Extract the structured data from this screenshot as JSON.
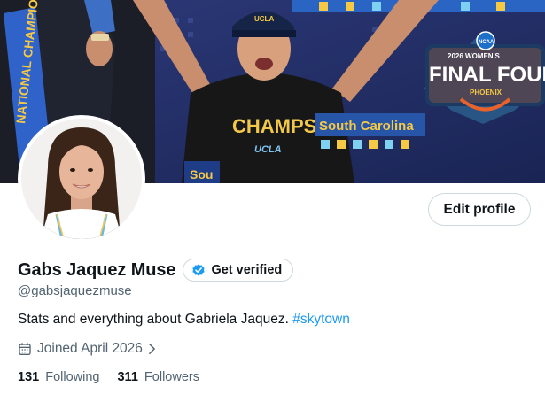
{
  "banner": {
    "left_banner_text": "NATIONAL CHAMPIONS",
    "shirt_text": "CHAMPS",
    "shirt_subtext": "UCLA",
    "sign_text": "South Carolina",
    "lower_sign_text": "Sou",
    "cap_text": "UCLA",
    "logo": {
      "top_line": "2026 WOMEN'S",
      "main_line": "FINAL FOUR",
      "city": "PHOENIX",
      "badge": "NCAA"
    }
  },
  "profile": {
    "edit_profile_label": "Edit profile",
    "display_name": "Gabs Jaquez Muse",
    "get_verified_label": "Get verified",
    "handle": "@gabsjaquezmuse",
    "bio_text": "Stats and everything about Gabriela Jaquez. ",
    "bio_hashtag": "#skytown",
    "joined_text": "Joined April 2026",
    "following_count": "131",
    "following_label": "Following",
    "followers_count": "311",
    "followers_label": "Followers"
  },
  "colors": {
    "accent_blue": "#1d9bf0",
    "text_primary": "#0f1419",
    "text_secondary": "#536471",
    "border": "#cfd9de"
  },
  "icons": {
    "verified": "verified-badge-icon",
    "calendar": "calendar-icon",
    "chevron": "chevron-right-icon"
  }
}
